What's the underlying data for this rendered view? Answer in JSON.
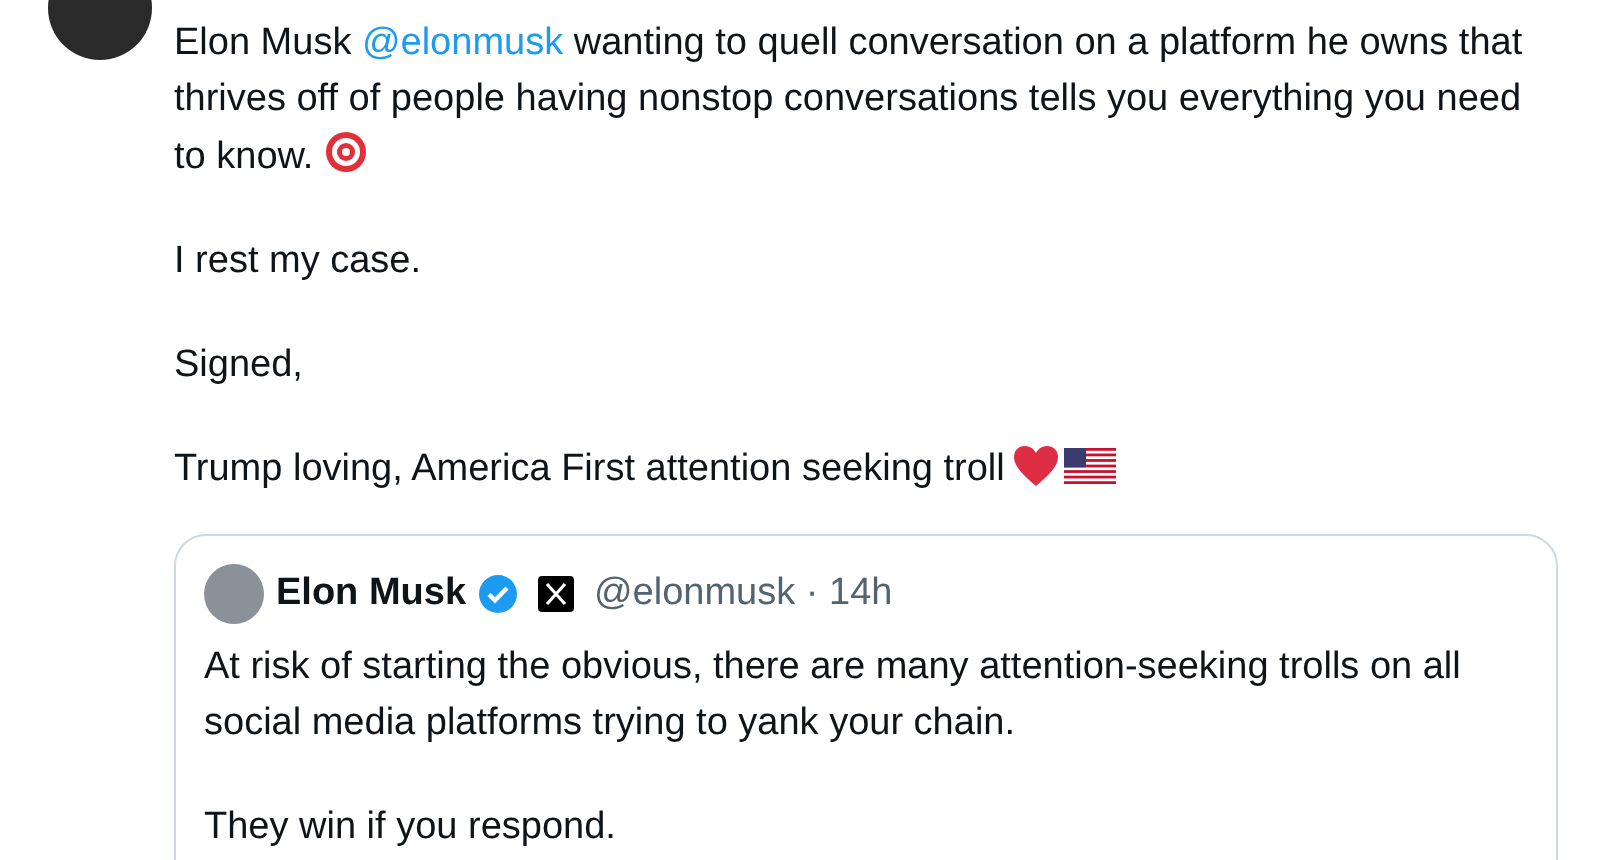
{
  "post": {
    "author_mention": {
      "name": "Elon Musk",
      "handle": "@elonmusk"
    },
    "paragraphs": [
      {
        "text": "wanting to quell conversation on a platform he owns that thrives off of people having nonstop conversations tells you everything you need to know.",
        "kind": "target"
      },
      {
        "text": "I rest my case.",
        "kind": "plain"
      },
      {
        "text": "Signed,",
        "kind": "plain"
      },
      {
        "text": "Trump loving, America First attention seeking troll",
        "kind": "heart-flag"
      }
    ]
  },
  "quoted_post": {
    "name": "Elon Musk",
    "verified": true,
    "handle": "@elonmusk",
    "separator": "·",
    "time": "14h",
    "paragraphs": [
      "At risk of starting the obvious, there are many attention-seeking trolls on all social media platforms trying to yank your chain.",
      "They win if you respond."
    ]
  }
}
